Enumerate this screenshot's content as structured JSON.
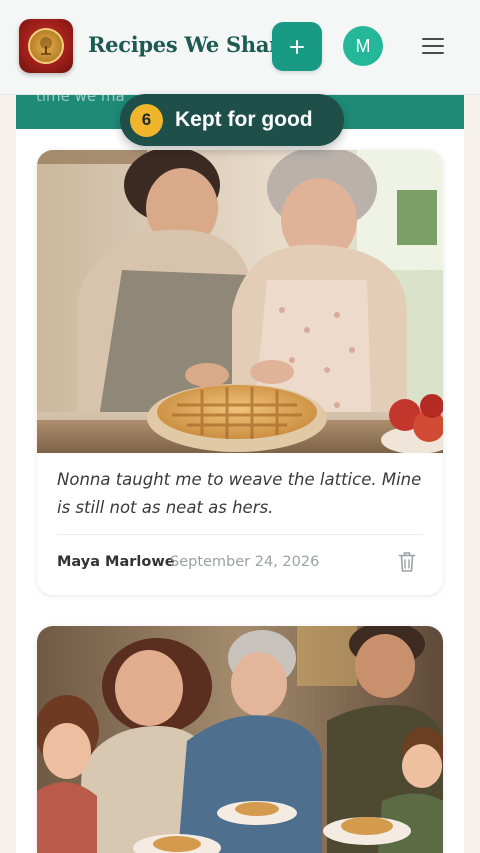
{
  "header": {
    "app_title": "Recipes We Share",
    "logo_icon": "tree-emblem-icon",
    "add_icon": "plus-icon",
    "avatar_initial": "M",
    "menu_icon": "hamburger-menu-icon",
    "colors": {
      "brand": "#1d5b52",
      "accent": "#199a85",
      "avatar": "#25b79a"
    }
  },
  "banner": {
    "partial_text": "time we ma"
  },
  "kept_indicator": {
    "count": "6",
    "label": "Kept for good",
    "colors": {
      "pill": "#1f4f49",
      "badge": "#f1b52b"
    }
  },
  "posts": [
    {
      "photo_alt": "Grandmother and daughter weaving a lattice pie crust in a kitchen",
      "caption": "Nonna taught me to weave the lattice. Mine is still not as neat as hers.",
      "author": "Maya Marlowe",
      "date": "September 24, 2026",
      "delete_icon": "trash-icon"
    },
    {
      "photo_alt": "Family sharing pie slices around a dinner table"
    }
  ]
}
